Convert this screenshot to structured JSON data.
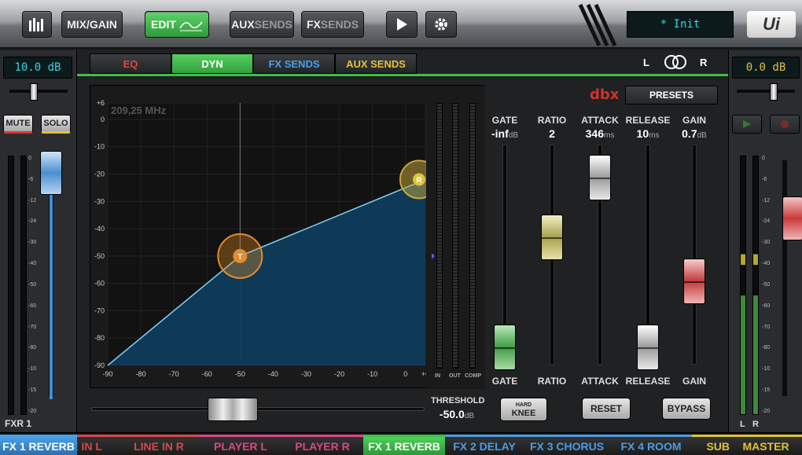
{
  "toolbar": {
    "mix_gain": "MIX/GAIN",
    "edit": "EDIT",
    "aux_sends_a": "AUX",
    "aux_sends_b": "SENDS",
    "fx_sends_a": "FX",
    "fx_sends_b": "SENDS",
    "preset_name": "* Init",
    "logo": "Ui"
  },
  "left_channel": {
    "gain": "10.0 dB",
    "mute": "MUTE",
    "solo": "SOLO",
    "name": "FXR 1",
    "scale": [
      "0",
      "-6",
      "-12",
      "-24",
      "-30",
      "-40",
      "-50",
      "-60",
      "-70",
      "-80",
      "-10",
      "-15",
      "-20"
    ]
  },
  "right_channel": {
    "gain": "0.0 dB",
    "name": "MASTER",
    "l": "L",
    "r": "R",
    "scale": [
      "0",
      "-6",
      "-12",
      "-24",
      "-30",
      "-40",
      "-50",
      "-60",
      "-70",
      "-80",
      "-10",
      "-15",
      "-20"
    ]
  },
  "tabs": [
    {
      "label": "EQ",
      "color": "#e04646"
    },
    {
      "label": "DYN",
      "color": "#ffffff"
    },
    {
      "label": "FX SENDS",
      "color": "#4a9de8"
    },
    {
      "label": "AUX SENDS",
      "color": "#e0c23a"
    }
  ],
  "stereo": {
    "l": "L",
    "r": "R"
  },
  "graph": {
    "freq": "209,25 MHz",
    "y_ticks": [
      "+6",
      "0",
      "-10",
      "-20",
      "-30",
      "-40",
      "-50",
      "-60",
      "-70",
      "-80",
      "-90"
    ],
    "x_ticks": [
      "-90",
      "-80",
      "-70",
      "-60",
      "-50",
      "-40",
      "-30",
      "-20",
      "-10",
      "0",
      "+6"
    ],
    "threshold_handle": "T",
    "ratio_handle": "R",
    "meters": {
      "in": "IN",
      "out": "OUT",
      "comp": "COMP"
    }
  },
  "threshold": {
    "label": "THRESHOLD",
    "value": "-50.0",
    "unit": "dB"
  },
  "brand": "dbx",
  "presets": "PRESETS",
  "params": [
    {
      "label": "GATE",
      "value": "-inf",
      "unit": "dB",
      "bottom": "GATE",
      "color": "green",
      "level": 0.08
    },
    {
      "label": "RATIO",
      "value": "2",
      "unit": "",
      "bottom": "RATIO",
      "color": "yellow",
      "level": 0.58
    },
    {
      "label": "ATTACK",
      "value": "346",
      "unit": "ms",
      "bottom": "ATTACK",
      "color": "white",
      "level": 0.85
    },
    {
      "label": "RELEASE",
      "value": "10",
      "unit": "ms",
      "bottom": "RELEASE",
      "color": "white",
      "level": 0.08
    },
    {
      "label": "GAIN",
      "value": "0.7",
      "unit": "dB",
      "bottom": "GAIN",
      "color": "red",
      "level": 0.38
    }
  ],
  "buttons": {
    "hard": "HARD",
    "knee": "KNEE",
    "reset": "RESET",
    "bypass": "BYPASS"
  },
  "channels": [
    {
      "label": "FX 1 REVERB",
      "color": "#4aa0e6",
      "active": true
    },
    {
      "label": "LINE IN L",
      "color": "#d84848"
    },
    {
      "label": "LINE IN R",
      "color": "#d84848"
    },
    {
      "label": "PLAYER L",
      "color": "#d84888"
    },
    {
      "label": "PLAYER R",
      "color": "#d84888"
    },
    {
      "label": "FX 1 REVERB",
      "color": "#3fbf4a",
      "active": true
    },
    {
      "label": "FX 2 DELAY",
      "color": "#4a9de8"
    },
    {
      "label": "FX 3 CHORUS",
      "color": "#4a9de8"
    },
    {
      "label": "FX 4 ROOM",
      "color": "#4a9de8"
    },
    {
      "label": "SUB",
      "color": "#e0c23a"
    },
    {
      "label": "MASTER",
      "color": "#e0c23a"
    }
  ]
}
